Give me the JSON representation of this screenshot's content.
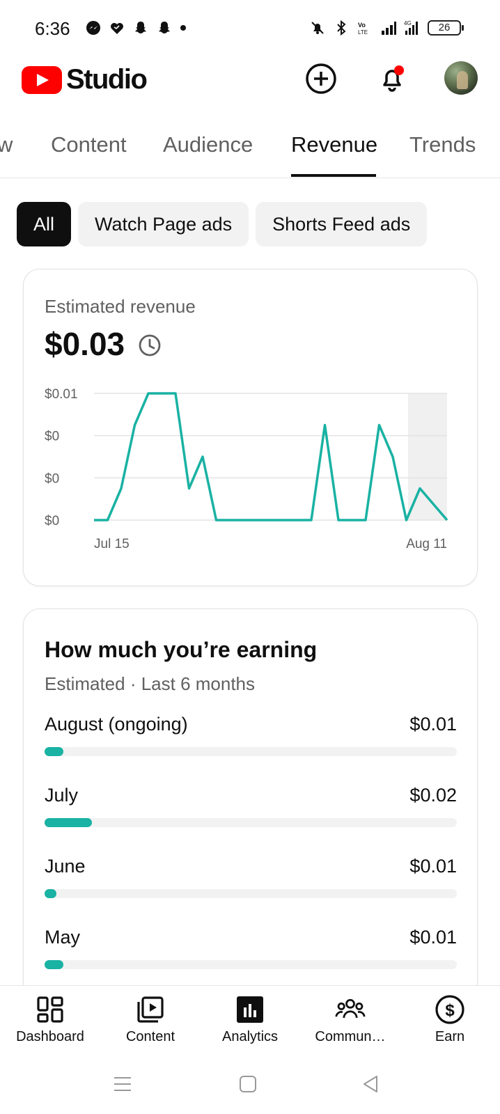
{
  "status_bar": {
    "time": "6:36",
    "battery": "26",
    "left_icons": [
      "messenger-icon",
      "heart-chat-icon",
      "snapchat-icon",
      "snapchat-icon",
      "dot-icon"
    ],
    "right_icons": [
      "mute-icon",
      "bluetooth-icon",
      "volte-icon",
      "signal-icon",
      "4g-signal-icon"
    ]
  },
  "header": {
    "brand": "Studio",
    "create_icon": "add-circle-icon",
    "notifications_icon": "bell-icon",
    "notification_dot_color": "#ff0000",
    "avatar_icon": "avatar"
  },
  "tabs": [
    {
      "label": "Overview",
      "visible_text": "w",
      "active": false
    },
    {
      "label": "Content",
      "active": false
    },
    {
      "label": "Audience",
      "active": false
    },
    {
      "label": "Revenue",
      "active": true
    },
    {
      "label": "Trends",
      "active": false
    }
  ],
  "chips": [
    {
      "label": "All",
      "active": true
    },
    {
      "label": "Watch Page ads",
      "active": false
    },
    {
      "label": "Shorts Feed ads",
      "active": false
    }
  ],
  "revenue_card": {
    "label": "Estimated revenue",
    "value": "$0.03",
    "info_icon": "clock-icon"
  },
  "chart_data": {
    "type": "line",
    "y_tick_labels": [
      "$0.01",
      "$0",
      "$0",
      "$0"
    ],
    "x_tick_labels": [
      "Jul 15",
      "Aug 11"
    ],
    "ylim": [
      0,
      0.01
    ],
    "grid": true,
    "line_color": "#19b2a3",
    "highlight_color": "#f0f0f0",
    "series": [
      {
        "values": [
          0,
          0,
          0.0025,
          0.0075,
          0.01,
          0.01,
          0.01,
          0.0025,
          0.005,
          0,
          0,
          0,
          0,
          0,
          0,
          0,
          0,
          0.0075,
          0,
          0,
          0,
          0.0075,
          0.005,
          0,
          0.0025,
          0.00125,
          0
        ]
      }
    ]
  },
  "earning_card": {
    "title": "How much you’re earning",
    "subtitle": "Estimated · Last 6 months",
    "bar_color": "#19b2a3",
    "months": [
      {
        "name": "August (ongoing)",
        "amount": "$0.01",
        "fraction": 0.045
      },
      {
        "name": "July",
        "amount": "$0.02",
        "fraction": 0.115
      },
      {
        "name": "June",
        "amount": "$0.01",
        "fraction": 0.028
      },
      {
        "name": "May",
        "amount": "$0.01",
        "fraction": 0.045
      }
    ]
  },
  "bottom_nav": [
    {
      "label": "Dashboard",
      "icon": "dashboard-icon",
      "active": false
    },
    {
      "label": "Content",
      "icon": "video-library-icon",
      "active": false
    },
    {
      "label": "Analytics",
      "icon": "analytics-icon",
      "active": true
    },
    {
      "label": "Commun…",
      "icon": "community-icon",
      "active": false
    },
    {
      "label": "Earn",
      "icon": "dollar-icon",
      "active": false
    }
  ],
  "system_nav": [
    "menu-icon",
    "home-icon",
    "back-icon"
  ]
}
